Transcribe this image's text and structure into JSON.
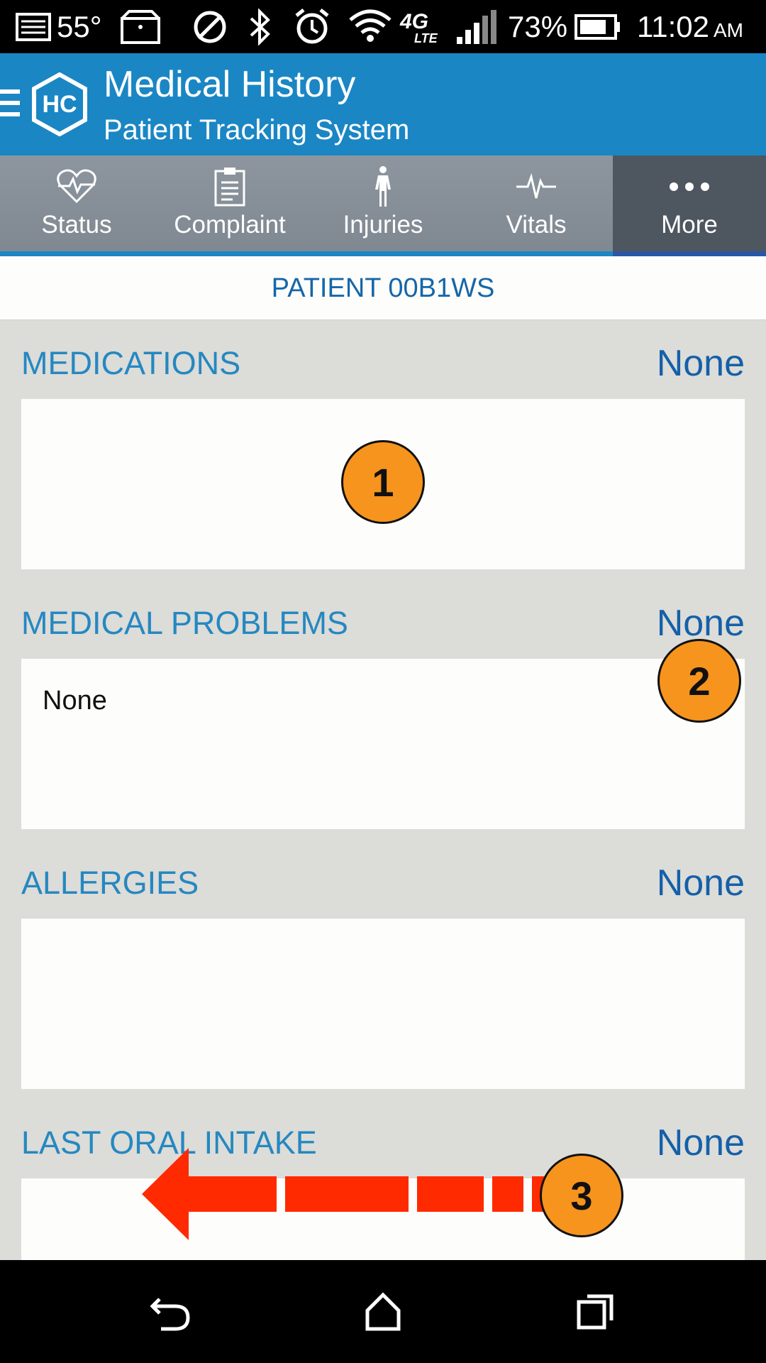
{
  "status_bar": {
    "temperature": "55°",
    "network": "4G LTE",
    "battery": "73%",
    "time": "11:02",
    "ampm": "AM"
  },
  "app_bar": {
    "logo_text": "HC",
    "title": "Medical History",
    "subtitle": "Patient Tracking System"
  },
  "tabs": [
    {
      "label": "Status",
      "icon": "heart-pulse-icon"
    },
    {
      "label": "Complaint",
      "icon": "clipboard-icon"
    },
    {
      "label": "Injuries",
      "icon": "body-icon"
    },
    {
      "label": "Vitals",
      "icon": "ecg-icon"
    },
    {
      "label": "More",
      "icon": "more-dots-icon",
      "active": true
    }
  ],
  "patient": {
    "label": "PATIENT 00B1WS"
  },
  "sections": [
    {
      "title": "MEDICATIONS",
      "value": "None",
      "content": ""
    },
    {
      "title": "MEDICAL PROBLEMS",
      "value": "None",
      "content": "None"
    },
    {
      "title": "ALLERGIES",
      "value": "None",
      "content": ""
    },
    {
      "title": "LAST ORAL INTAKE",
      "value": "None",
      "content": ""
    }
  ],
  "annotations": {
    "m1": "1",
    "m2": "2",
    "m3": "3"
  },
  "colors": {
    "app_bar": "#1b86c4",
    "section_title": "#2588c0",
    "section_value": "#1560a8",
    "marker": "#f7941d",
    "arrow": "#ff2a00"
  }
}
